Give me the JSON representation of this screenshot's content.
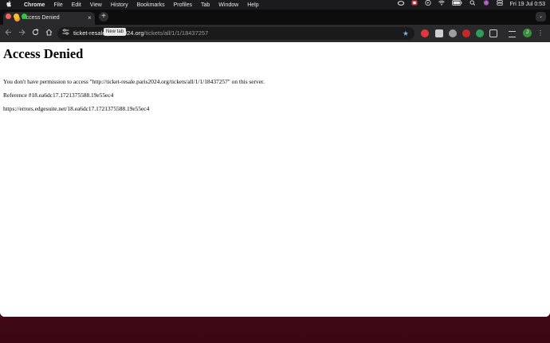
{
  "menubar": {
    "app_name": "Chrome",
    "items": [
      "File",
      "Edit",
      "View",
      "History",
      "Bookmarks",
      "Profiles",
      "Tab",
      "Window",
      "Help"
    ],
    "clock": "Fri 19 Jul  0:53",
    "status_icons": [
      "creative-cloud-icon",
      "vpn-icon",
      "play-icon",
      "wifi-icon",
      "battery-icon",
      "search-icon",
      "siri-icon",
      "control-center-icon"
    ]
  },
  "browser": {
    "tab": {
      "title": "Access Denied",
      "close_glyph": "×"
    },
    "new_tab": {
      "glyph": "+",
      "tooltip": "New tab"
    },
    "tab_search_glyph": "⌄",
    "address_bar": {
      "host": "ticket-resale.paris2024.org",
      "path": "/tickets/all/1/1/18437257"
    },
    "profile_initial": "J",
    "accent_color": "#64b5f6"
  },
  "page": {
    "heading": "Access Denied",
    "message": "You don't have permission to access \"http://ticket-resale.paris2024.org/tickets/all/1/1/18437257\" on this server.",
    "reference": "Reference #18.ea6dc17.1721375588.19e55ec4",
    "error_url": "https://errors.edgesuite.net/18.ea6dc17.1721375588.19e55ec4"
  }
}
